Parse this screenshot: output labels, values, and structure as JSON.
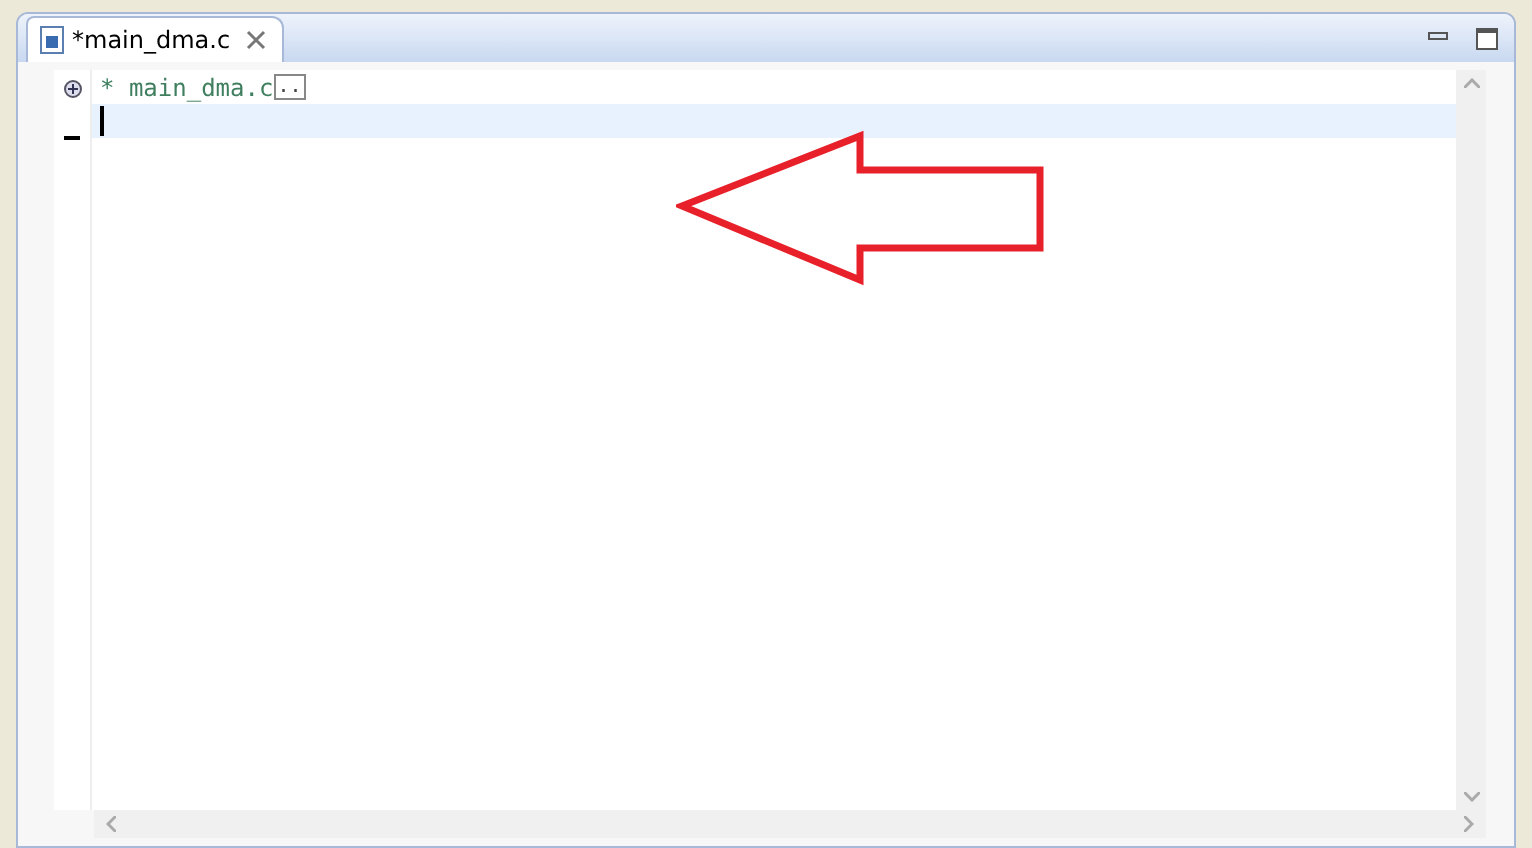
{
  "editor_tab": {
    "title": "*main_dma.c",
    "selected": true
  },
  "lines": [
    {
      "text": "* main_dma.c",
      "folded": true,
      "fold_marker": "..",
      "current": false
    },
    {
      "folded": false,
      "current": true
    }
  ]
}
